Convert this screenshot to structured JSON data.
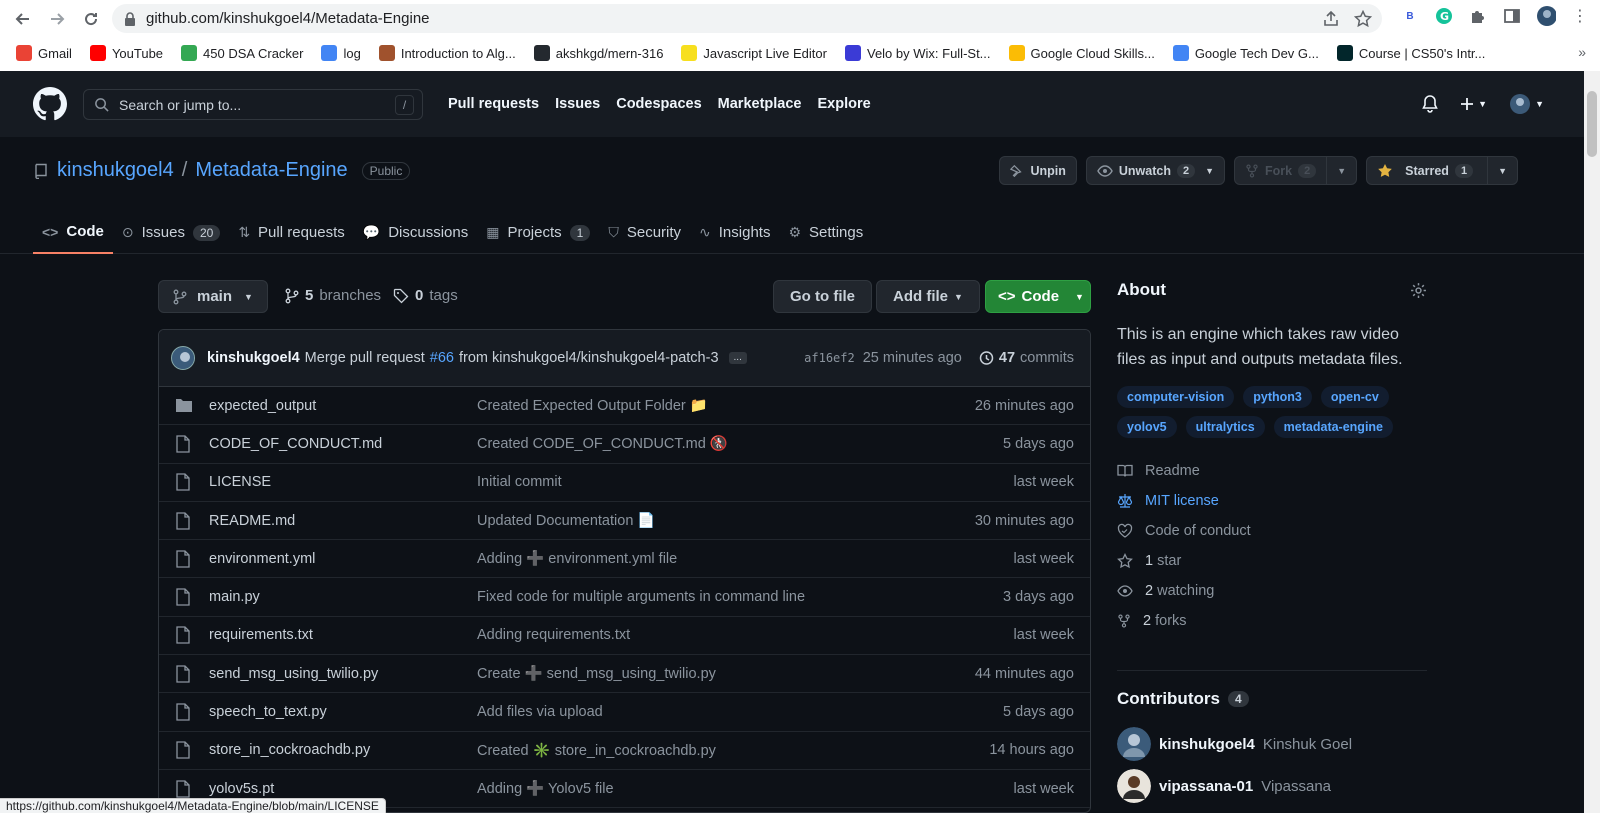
{
  "browser": {
    "url": "github.com/kinshukgoel4/Metadata-Engine",
    "bookmarks": [
      {
        "label": "Gmail",
        "icon": "gmail-icon",
        "color": "#ea4335"
      },
      {
        "label": "YouTube",
        "icon": "youtube-icon",
        "color": "#ff0000"
      },
      {
        "label": "450 DSA Cracker",
        "icon": "dsa-icon",
        "color": "#34a853"
      },
      {
        "label": "log",
        "icon": "log-icon",
        "color": "#4285f4"
      },
      {
        "label": "Introduction to Alg...",
        "icon": "book-icon",
        "color": "#a0522d"
      },
      {
        "label": "akshkgd/mern-316",
        "icon": "github-icon",
        "color": "#24292f"
      },
      {
        "label": "Javascript Live Editor",
        "icon": "js-icon",
        "color": "#f7df1e"
      },
      {
        "label": "Velo by Wix: Full-St...",
        "icon": "velo-icon",
        "color": "#3b3bd6"
      },
      {
        "label": "Google Cloud Skills...",
        "icon": "cloud-icon",
        "color": "#fbbc05"
      },
      {
        "label": "Google Tech Dev G...",
        "icon": "google-icon",
        "color": "#4285f4"
      },
      {
        "label": "Course | CS50's Intr...",
        "icon": "edx-icon",
        "color": "#02262b"
      }
    ],
    "status_url": "https://github.com/kinshukgoel4/Metadata-Engine/blob/main/LICENSE"
  },
  "gh_header": {
    "search_placeholder": "Search or jump to...",
    "slash": "/",
    "nav": [
      "Pull requests",
      "Issues",
      "Codespaces",
      "Marketplace",
      "Explore"
    ]
  },
  "repo": {
    "owner": "kinshukgoel4",
    "separator": "/",
    "name": "Metadata-Engine",
    "visibility": "Public",
    "unpin": "Unpin",
    "unwatch": "Unwatch",
    "watch_count": "2",
    "fork": "Fork",
    "fork_count": "2",
    "starred": "Starred",
    "star_count": "1",
    "tabs": [
      {
        "label": "Code",
        "count": ""
      },
      {
        "label": "Issues",
        "count": "20"
      },
      {
        "label": "Pull requests",
        "count": ""
      },
      {
        "label": "Discussions",
        "count": ""
      },
      {
        "label": "Projects",
        "count": "1"
      },
      {
        "label": "Security",
        "count": ""
      },
      {
        "label": "Insights",
        "count": ""
      },
      {
        "label": "Settings",
        "count": ""
      }
    ]
  },
  "branch_bar": {
    "branch": "main",
    "branches_count": "5",
    "branches_label": "branches",
    "tags_count": "0",
    "tags_label": "tags",
    "go_to_file": "Go to file",
    "add_file": "Add file",
    "code": "Code"
  },
  "commit": {
    "author": "kinshukgoel4",
    "message_pre": "Merge pull request",
    "pr": "#66",
    "message_post": "from kinshukgoel4/kinshukgoel4-patch-3",
    "ellipsis": "...",
    "sha": "af16ef2",
    "time": "25 minutes ago",
    "commits_count": "47",
    "commits_label": "commits"
  },
  "files": [
    {
      "name": "expected_output",
      "type": "dir",
      "msg": "Created Expected Output Folder 📁",
      "age": "26 minutes ago"
    },
    {
      "name": "CODE_OF_CONDUCT.md",
      "type": "file",
      "msg": "Created CODE_OF_CONDUCT.md 🚷",
      "age": "5 days ago"
    },
    {
      "name": "LICENSE",
      "type": "file",
      "msg": "Initial commit",
      "age": "last week"
    },
    {
      "name": "README.md",
      "type": "file",
      "msg": "Updated Documentation 📄",
      "age": "30 minutes ago"
    },
    {
      "name": "environment.yml",
      "type": "file",
      "msg": "Adding ➕ environment.yml file",
      "age": "last week"
    },
    {
      "name": "main.py",
      "type": "file",
      "msg": "Fixed code for multiple arguments in command line",
      "age": "3 days ago"
    },
    {
      "name": "requirements.txt",
      "type": "file",
      "msg": "Adding requirements.txt",
      "age": "last week"
    },
    {
      "name": "send_msg_using_twilio.py",
      "type": "file",
      "msg": "Create ➕ send_msg_using_twilio.py",
      "age": "44 minutes ago"
    },
    {
      "name": "speech_to_text.py",
      "type": "file",
      "msg": "Add files via upload",
      "age": "5 days ago"
    },
    {
      "name": "store_in_cockroachdb.py",
      "type": "file",
      "msg": "Created ✳️ store_in_cockroachdb.py",
      "age": "14 hours ago"
    },
    {
      "name": "yolov5s.pt",
      "type": "file",
      "msg": "Adding ➕ Yolov5 file",
      "age": "last week"
    }
  ],
  "about": {
    "title": "About",
    "description": "This is an engine which takes raw video files as input and outputs metadata files.",
    "topics": [
      "computer-vision",
      "python3",
      "open-cv",
      "yolov5",
      "ultralytics",
      "metadata-engine"
    ],
    "readme": "Readme",
    "license": "MIT license",
    "conduct": "Code of conduct",
    "stars_count": "1",
    "stars_label": "star",
    "watching_count": "2",
    "watching_label": "watching",
    "forks_count": "2",
    "forks_label": "forks"
  },
  "contributors": {
    "title": "Contributors",
    "count": "4",
    "list": [
      {
        "login": "kinshukgoel4",
        "name": "Kinshuk Goel"
      },
      {
        "login": "vipassana-01",
        "name": "Vipassana"
      }
    ]
  },
  "colors": {
    "accent": "#58a6ff",
    "green": "#238636",
    "active_tab": "#f78166",
    "bg": "#0d1117"
  }
}
